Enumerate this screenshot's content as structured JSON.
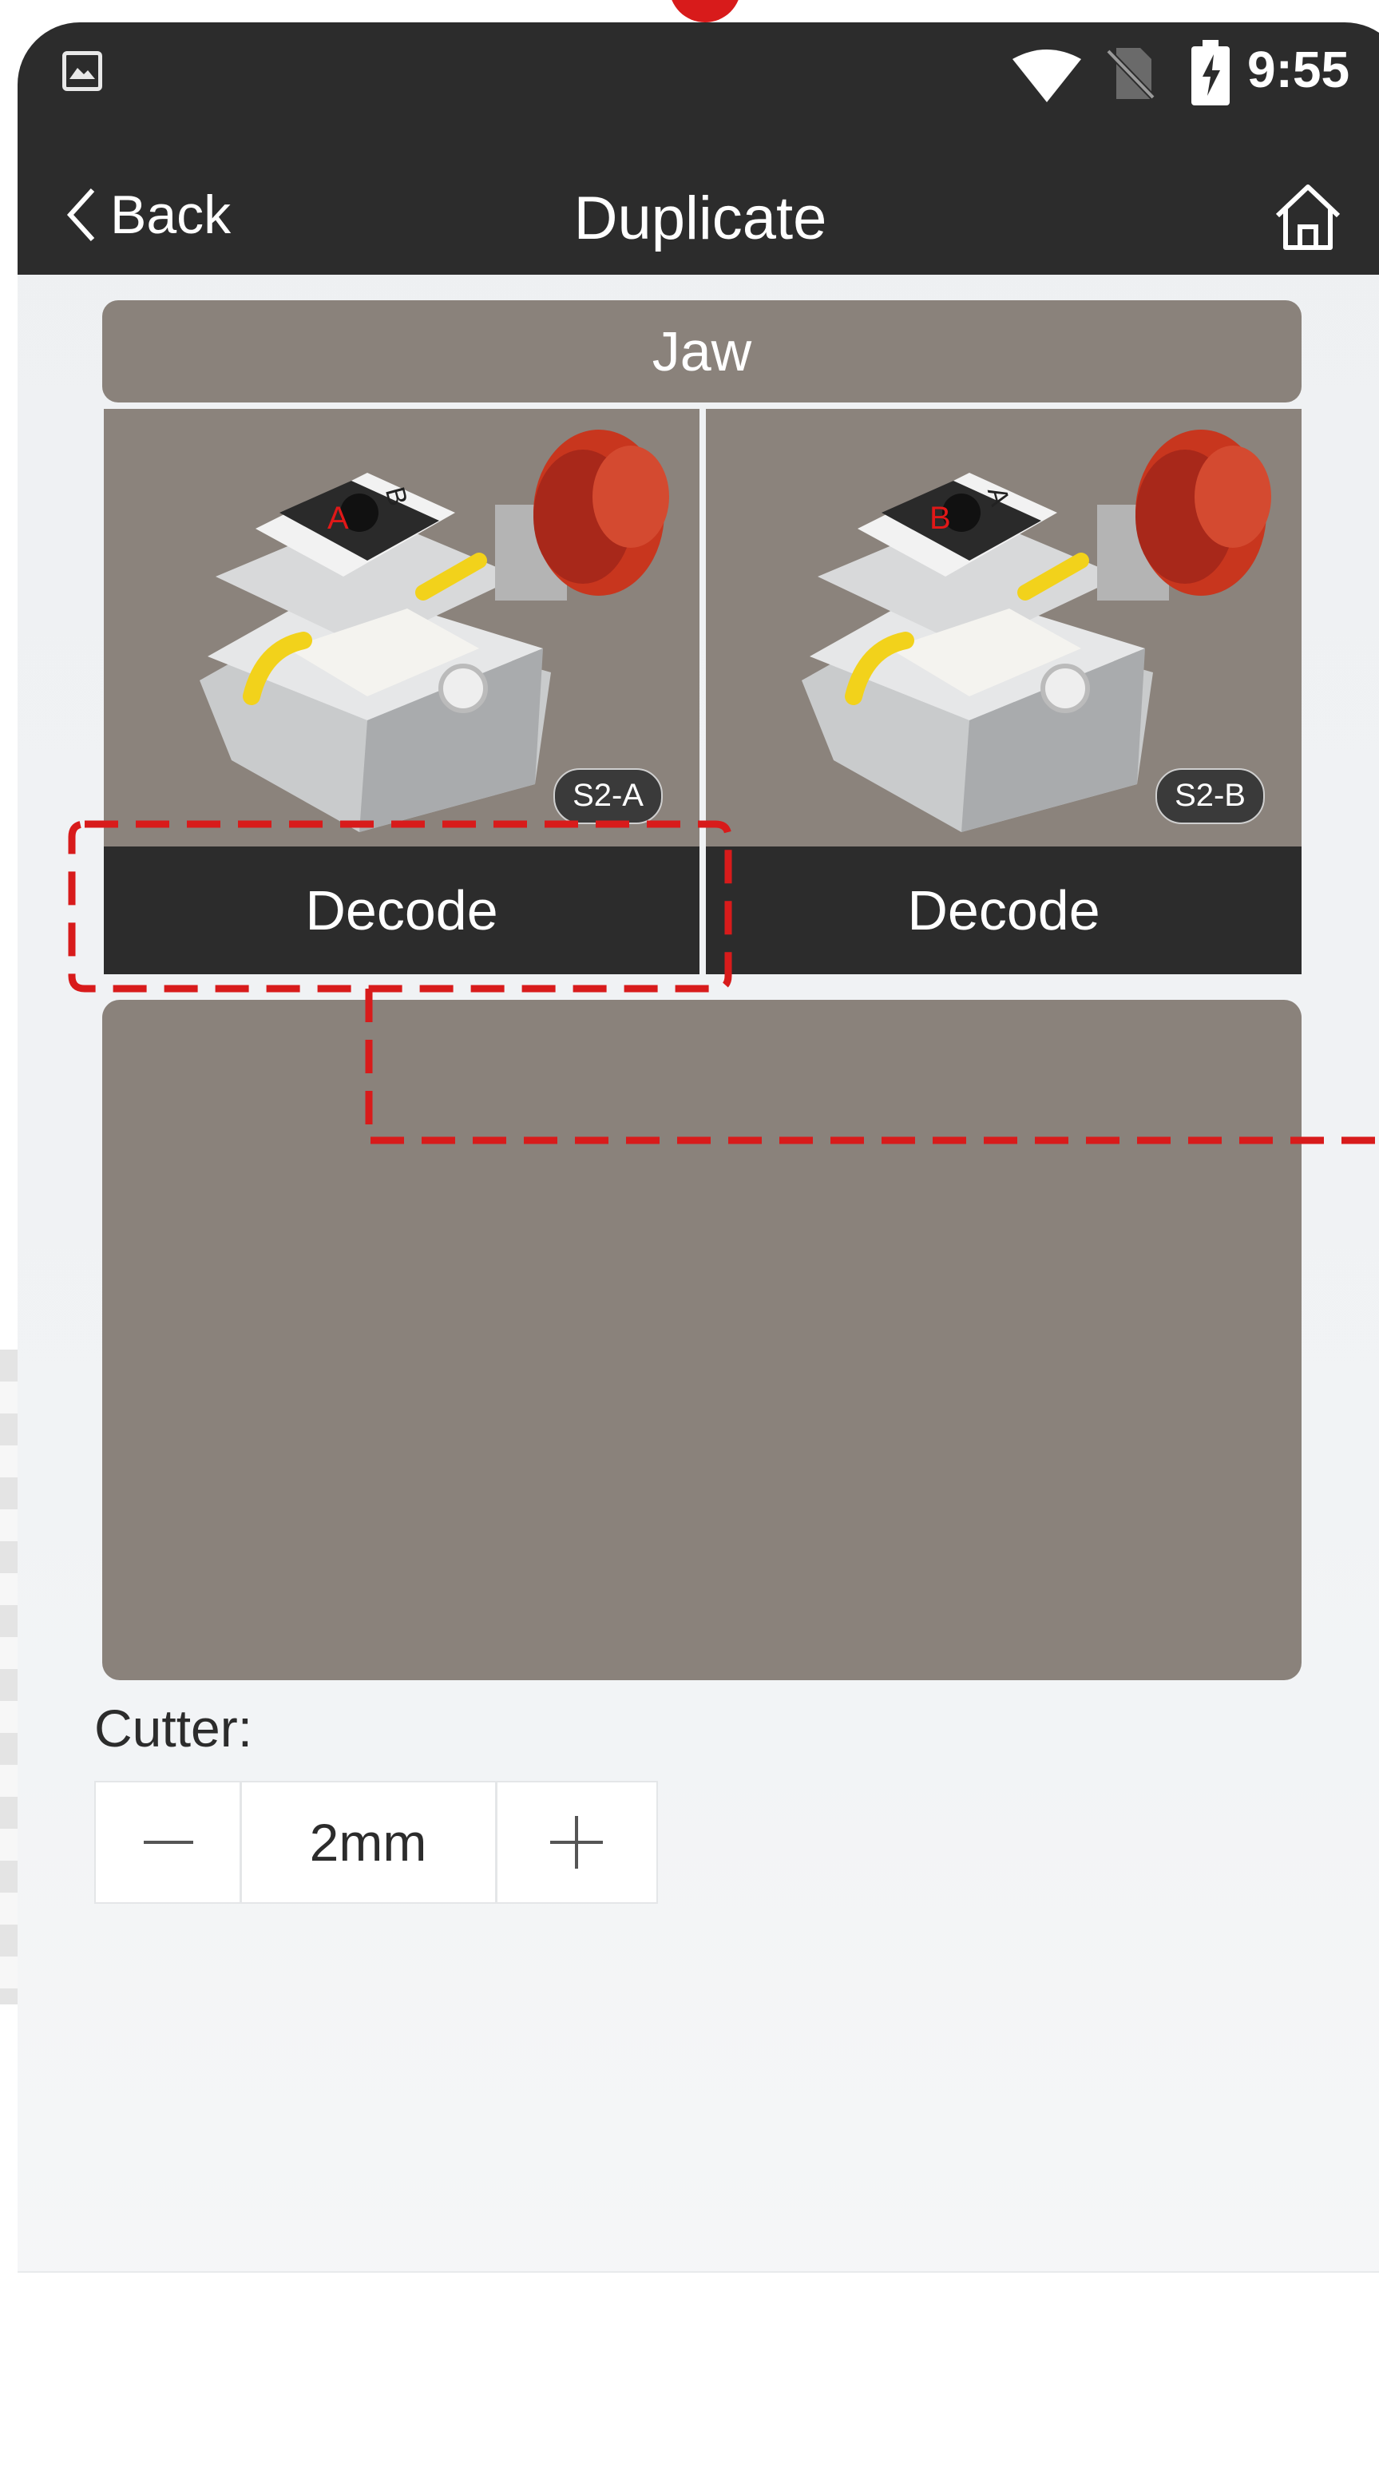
{
  "status_bar": {
    "time": "9:55",
    "icons": [
      "image-notification-icon",
      "wifi-icon",
      "no-sim-icon",
      "battery-charging-icon"
    ]
  },
  "nav": {
    "back_label": "Back",
    "title": "Duplicate",
    "home_icon": "home-icon"
  },
  "jaw": {
    "header": "Jaw",
    "options": [
      {
        "tag": "S2-A",
        "button_label": "Decode",
        "face_label": "A"
      },
      {
        "tag": "S2-B",
        "button_label": "Decode",
        "face_label": "B"
      }
    ]
  },
  "cutter": {
    "label": "Cutter:",
    "value": "2mm"
  },
  "colors": {
    "bar": "#2c2c2c",
    "panel": "#8a827b",
    "background": "#eef0f2",
    "annotation": "#d81b1b",
    "knob": "#c8361e",
    "arrow": "#f2d21b"
  }
}
